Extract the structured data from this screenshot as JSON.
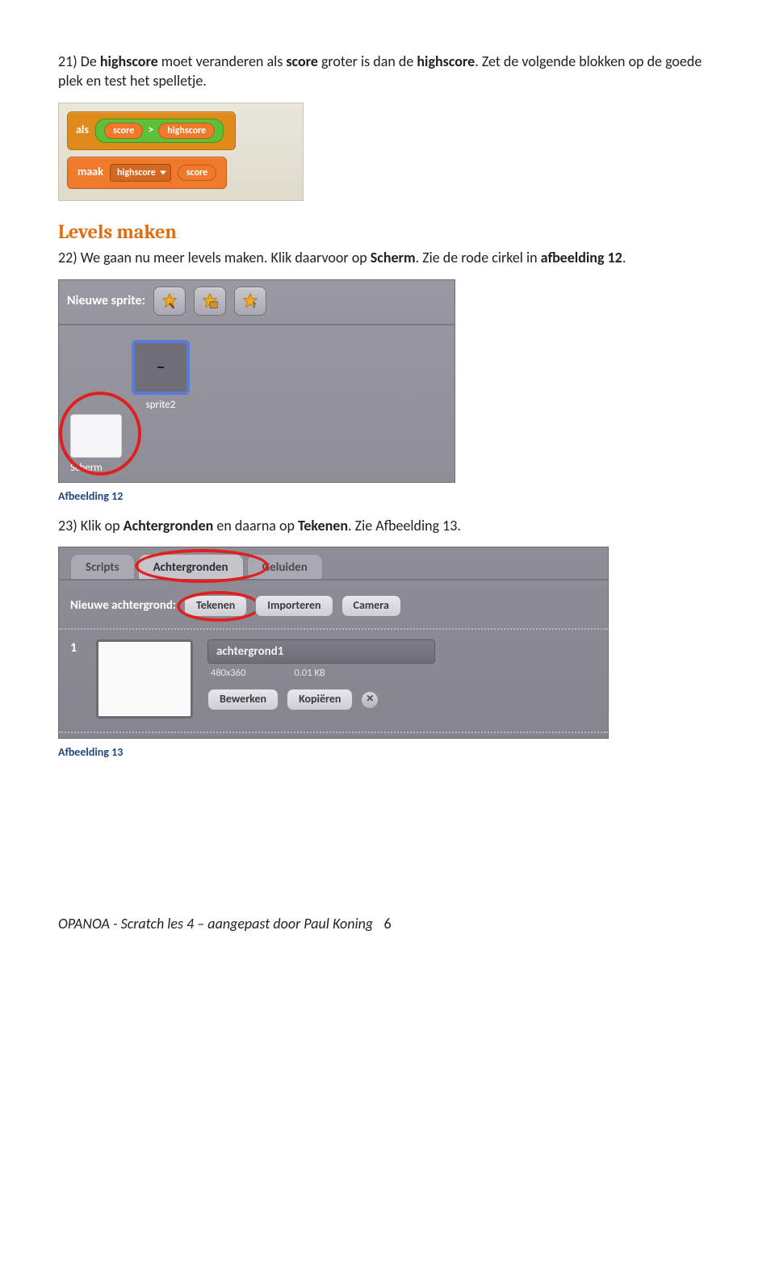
{
  "para1": {
    "pre": "21) De ",
    "b1": "highscore",
    "mid1": " moet veranderen als ",
    "b2": "score",
    "mid2": " groter is dan de ",
    "b3": "highscore",
    "post": ". Zet de volgende blokken op de goede plek en test het spelletje."
  },
  "scratch": {
    "als": "als",
    "var_score": "score",
    "gt": ">",
    "var_high": "highscore",
    "maak": "maak",
    "drop": "highscore",
    "set_to": "score"
  },
  "heading1": "Levels maken",
  "para2": {
    "pre": "22) We gaan nu meer levels maken. Klik daarvoor op ",
    "b1": "Scherm",
    "mid": ". Zie de rode cirkel in ",
    "b2": "afbeelding 12",
    "post": "."
  },
  "sprite_panel": {
    "title": "Nieuwe sprite:",
    "sprite_label": "sprite2",
    "stage_label": "Scherm"
  },
  "caption12": "Afbeelding 12",
  "para3": {
    "pre": "23) Klik op ",
    "b1": "Achtergronden",
    "mid": " en daarna op ",
    "b2": "Tekenen",
    "post": ". Zie Afbeelding 13."
  },
  "bg_panel": {
    "tabs": {
      "t1": "Scripts",
      "t2": "Achtergronden",
      "t3": "Geluiden"
    },
    "row_label": "Nieuwe achtergrond:",
    "btn1": "Tekenen",
    "btn2": "Importeren",
    "btn3": "Camera",
    "item": {
      "index": "1",
      "name": "achtergrond1",
      "dims": "480x360",
      "size": "0.01 KB",
      "edit": "Bewerken",
      "copy": "Kopiëren"
    }
  },
  "caption13": "Afbeelding 13",
  "footer": {
    "page": "6",
    "left": "OPANOA - Scratch les 4 – aangepast door Paul Koning"
  }
}
